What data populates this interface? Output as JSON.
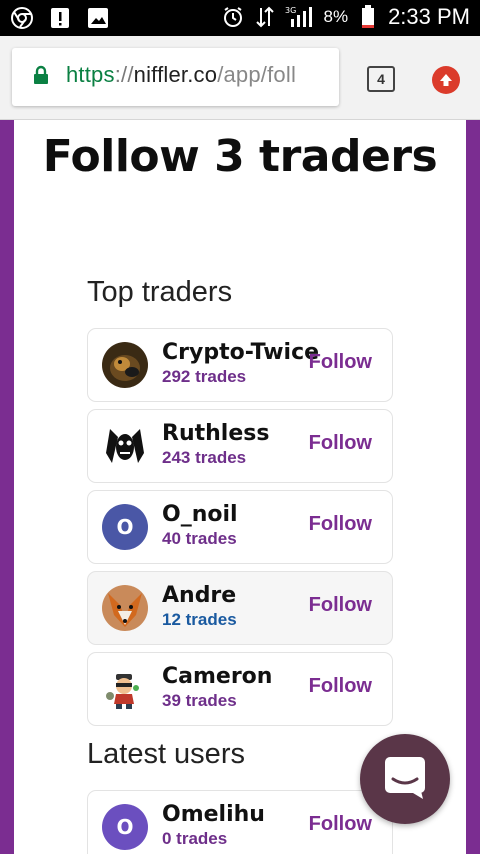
{
  "status_bar": {
    "battery": "8%",
    "network": "3G",
    "time": "2:33 PM"
  },
  "browser": {
    "url_scheme": "https",
    "url_sep": "://",
    "url_host": "niffler.co",
    "url_path": "/app/foll",
    "tab_count": "4"
  },
  "page": {
    "title": "Follow 3 traders"
  },
  "top_traders": {
    "label": "Top traders",
    "items": [
      {
        "name": "Crypto-Twice",
        "trades": "292 trades",
        "follow": "Follow"
      },
      {
        "name": "Ruthless",
        "trades": "243 trades",
        "follow": "Follow"
      },
      {
        "name": "O_noil",
        "trades": "40 trades",
        "follow": "Follow",
        "avatar_letter": "O",
        "avatar_color": "#4a57a6"
      },
      {
        "name": "Andre",
        "trades": "12 trades",
        "follow": "Follow"
      },
      {
        "name": "Cameron",
        "trades": "39 trades",
        "follow": "Follow"
      }
    ]
  },
  "latest_users": {
    "label": "Latest users",
    "items": [
      {
        "name": "Omelihu",
        "trades": "0 trades",
        "follow": "Follow",
        "avatar_letter": "O",
        "avatar_color": "#6b4fbf"
      }
    ]
  },
  "colors": {
    "brand_purple": "#7b2d91",
    "chat_bubble": "#5a3648"
  }
}
